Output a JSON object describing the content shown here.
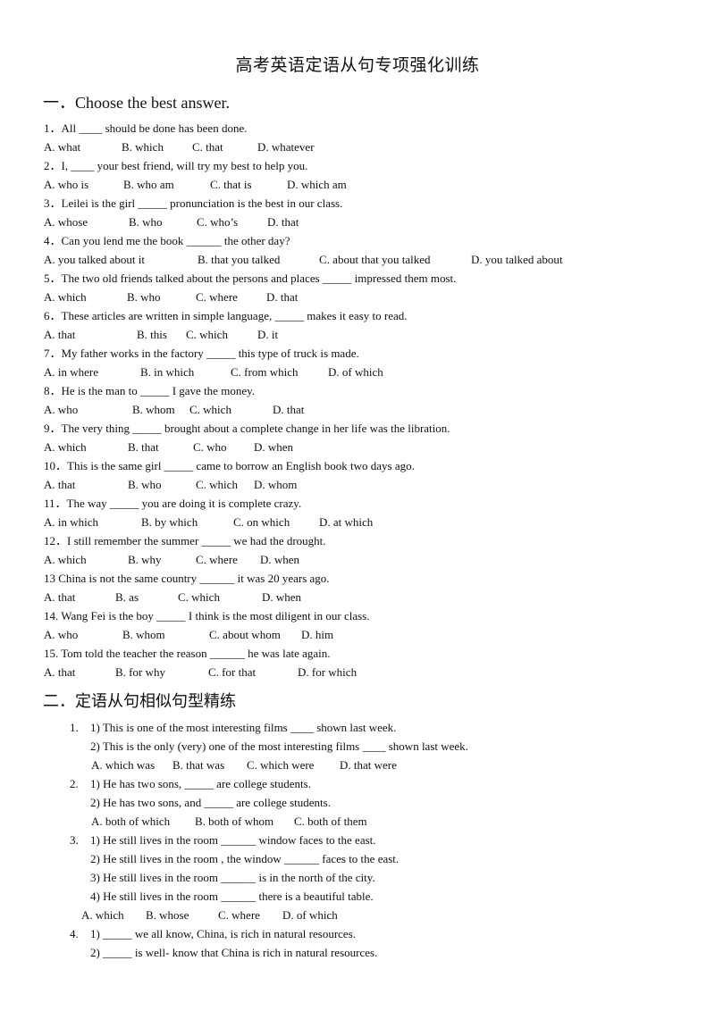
{
  "document": {
    "title": "高考英语定语从句专项强化训练",
    "section1": {
      "heading": "一．Choose the best answer.",
      "questions": [
        {
          "text": "1．All ____ should be done has been done.",
          "options": [
            "A. what",
            "B. which",
            "C. that",
            "D. whatever"
          ]
        },
        {
          "text": "2．I, ____ your best friend, will try my best to help you.",
          "options": [
            "A. who is",
            "B. who am",
            "C. that is",
            "D. which am"
          ]
        },
        {
          "text": "3．Leilei is the girl _____ pronunciation is the best in our class.",
          "options": [
            "A. whose",
            "B. who",
            "C. who’s",
            "D. that"
          ]
        },
        {
          "text": "4．Can you lend me the book ______ the other day?",
          "options": [
            "A. you talked about it",
            "B. that you talked",
            "C. about that you talked",
            "D. you talked about"
          ]
        },
        {
          "text": "5．The two old friends talked about the persons and places _____ impressed them most.",
          "options": [
            "A. which",
            "B. who",
            "C. where",
            "D. that"
          ]
        },
        {
          "text": "6．These articles are written in simple language, _____ makes it easy to read.",
          "options": [
            "A. that",
            "B. this",
            "C. which",
            "D. it"
          ]
        },
        {
          "text": "7．My father works in the factory _____ this type of truck is made.",
          "options": [
            "A. in where",
            "B. in which",
            "C. from which",
            "D. of which"
          ]
        },
        {
          "text": "8．He is the man to _____ I gave the money.",
          "options": [
            "A. who",
            "B. whom",
            "C. which",
            "D. that"
          ]
        },
        {
          "text": "9．The very thing _____ brought about a complete change in her life was the libration.",
          "options": [
            "A. which",
            "B. that",
            "C. who",
            "D. when"
          ]
        },
        {
          "text": "10．This is the same girl _____ came to borrow an English book two days ago.",
          "options": [
            "A. that",
            "B. who",
            "C. which",
            "D. whom"
          ]
        },
        {
          "text": "11．The way _____ you are doing it is complete crazy.",
          "options": [
            "A. in which",
            "B. by which",
            "C. on which",
            "D. at which"
          ]
        },
        {
          "text": "12．I still remember the summer _____ we had the drought.",
          "options": [
            "A. which",
            "B. why",
            "C. where",
            "D. when"
          ]
        },
        {
          "text": "13 China is not the same country ______ it was 20 years ago.",
          "options": [
            "A. that",
            "B. as",
            "C. which",
            "D. when"
          ]
        },
        {
          "text": "14. Wang Fei is the boy _____ I think is the most diligent in our class.",
          "options": [
            "A. who",
            "B. whom",
            "C. about whom",
            "D. him"
          ]
        },
        {
          "text": "15. Tom told the teacher the reason ______ he was late again.",
          "options": [
            "A. that",
            "B. for why",
            "C. for that",
            "D. for which"
          ]
        }
      ]
    },
    "section2": {
      "heading": "二．定语从句相似句型精练",
      "groups": [
        {
          "number": "1.",
          "sentences": [
            "1) This is one of the most interesting films ____ shown last week.",
            "2) This is the only (very) one of the most interesting films ____ shown last week."
          ],
          "options": [
            "A. which was",
            "B. that was",
            "C. which were",
            "D. that were"
          ]
        },
        {
          "number": "2.",
          "sentences": [
            "1) He has two sons, _____ are college students.",
            "2) He has two sons, and   _____ are college students."
          ],
          "options": [
            "A. both of which",
            "B. both of whom",
            "C. both of them"
          ]
        },
        {
          "number": "3.",
          "sentences": [
            "1) He still lives in the room ______ window faces to the east.",
            "2) He still lives in the room , the window ______ faces to the east.",
            "3) He still lives in the room ______ is in the north of the city.",
            "4) He still lives in the room ______ there is a beautiful table."
          ],
          "options": [
            "A. which",
            "B. whose",
            "C. where",
            "D. of which"
          ]
        },
        {
          "number": "4.",
          "sentences": [
            "1) _____ we all know, China, is rich in natural resources.",
            "2) _____ is well- know that China is rich in natural resources."
          ],
          "options": []
        }
      ]
    }
  }
}
